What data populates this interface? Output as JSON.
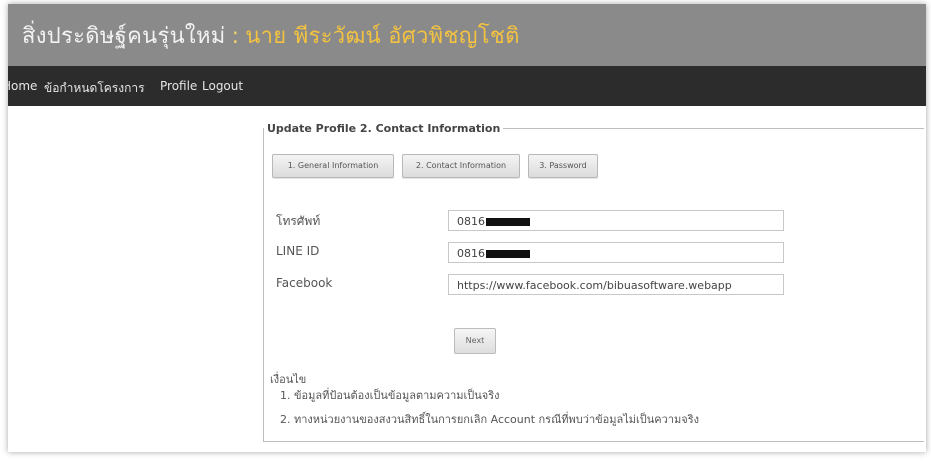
{
  "header": {
    "site_title": "สิ่งประดิษฐ์คนรุ่นใหม่",
    "separator": ":",
    "user_name": "นาย พีระวัฒน์ อัศวพิชญโชติ"
  },
  "nav": {
    "items": [
      {
        "label": "Home"
      },
      {
        "label": "ข้อกำหนดโครงการ"
      },
      {
        "label": "Profile"
      },
      {
        "label": "Logout"
      }
    ]
  },
  "panel": {
    "legend": "Update Profile 2. Contact Information"
  },
  "tabs": [
    {
      "label": "1. General Information"
    },
    {
      "label": "2. Contact Information"
    },
    {
      "label": "3. Password"
    }
  ],
  "form": {
    "phone": {
      "label": "โทรศัพท์",
      "value": "0816"
    },
    "line_id": {
      "label": "LINE ID",
      "value": "0816"
    },
    "facebook": {
      "label": "Facebook",
      "value": "https://www.facebook.com/bibuasoftware.webapp"
    }
  },
  "next_label": "Next",
  "notes": {
    "title": "เงื่อนไข",
    "items": [
      "1.  ข้อมูลที่ป้อนต้องเป็นข้อมูลตามความเป็นจริง",
      "2.  ทางหน่วยงานของสงวนสิทธิ์ในการยกเลิก Account กรณีที่พบว่าข้อมูลไม่เป็นความจริง"
    ]
  },
  "colors": {
    "header_bg": "#8a8a8a",
    "navbar_bg": "#2c2c2c",
    "user_name": "#f3c240"
  }
}
